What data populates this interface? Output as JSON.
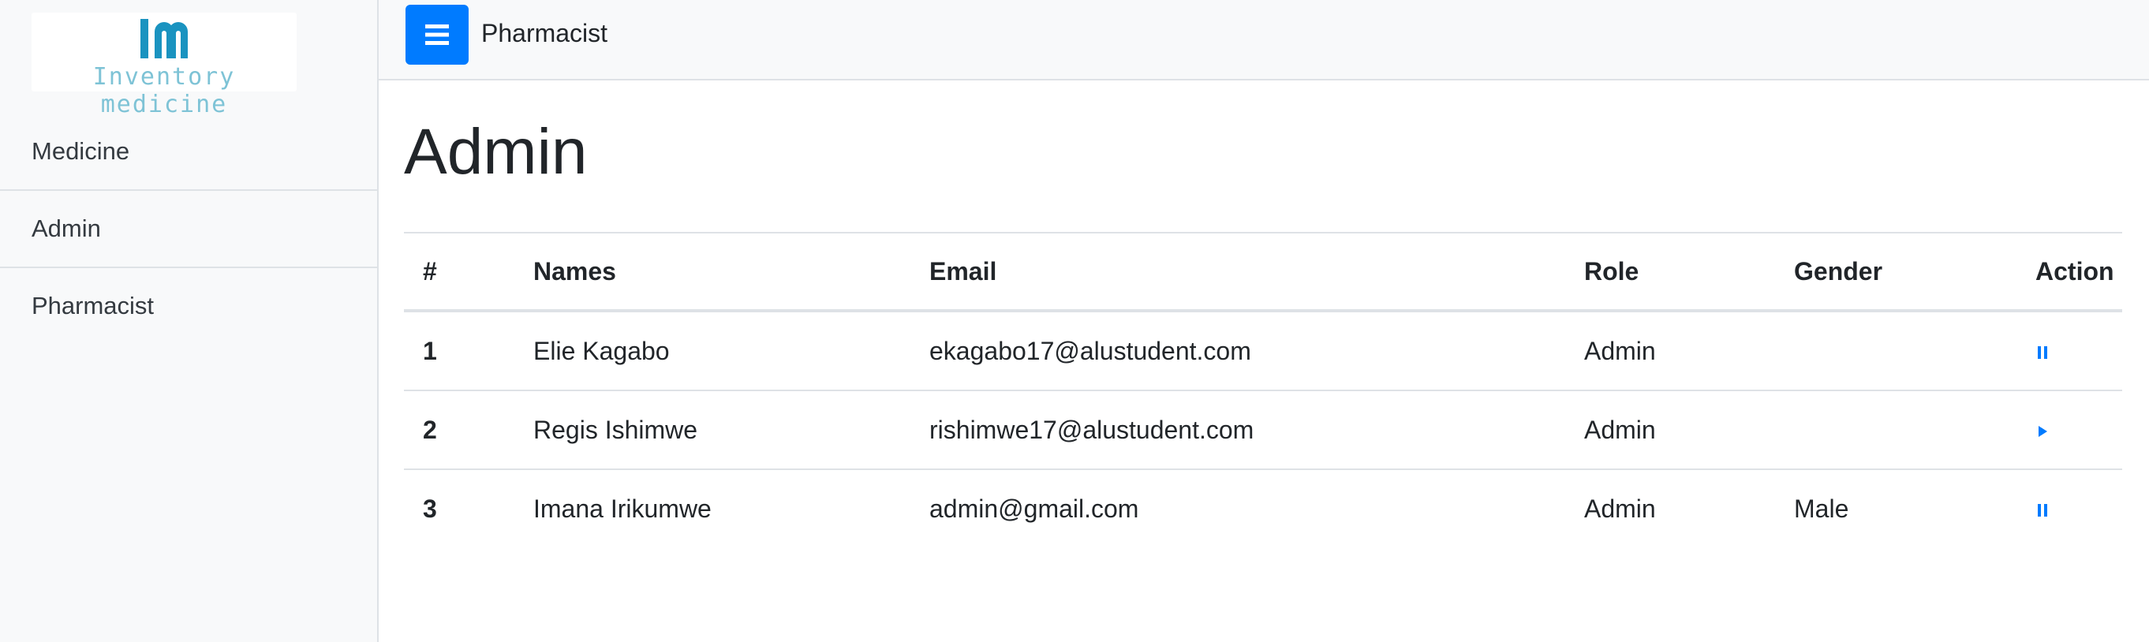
{
  "logo": {
    "text": "Inventory medicine",
    "icon": "im-monogram-logo",
    "color_primary": "#1a93c0",
    "color_secondary": "#7ec3d6"
  },
  "sidebar": {
    "items": [
      {
        "label": "Medicine"
      },
      {
        "label": "Admin"
      },
      {
        "label": "Pharmacist"
      }
    ]
  },
  "topbar": {
    "menu_icon": "hamburger-menu-icon",
    "title": "Pharmacist",
    "accent": "#007bff"
  },
  "main": {
    "title": "Admin",
    "table": {
      "headers": {
        "index": "#",
        "names": "Names",
        "email": "Email",
        "role": "Role",
        "gender": "Gender",
        "action": "Action"
      },
      "rows": [
        {
          "index": "1",
          "names": "Elie Kagabo",
          "email": "ekagabo17@alustudent.com",
          "role": "Admin",
          "gender": "",
          "action_icon": "pause-icon"
        },
        {
          "index": "2",
          "names": "Regis Ishimwe",
          "email": "rishimwe17@alustudent.com",
          "role": "Admin",
          "gender": "",
          "action_icon": "play-icon"
        },
        {
          "index": "3",
          "names": "Imana Irikumwe",
          "email": "admin@gmail.com",
          "role": "Admin",
          "gender": "Male",
          "action_icon": "pause-icon"
        }
      ]
    }
  }
}
